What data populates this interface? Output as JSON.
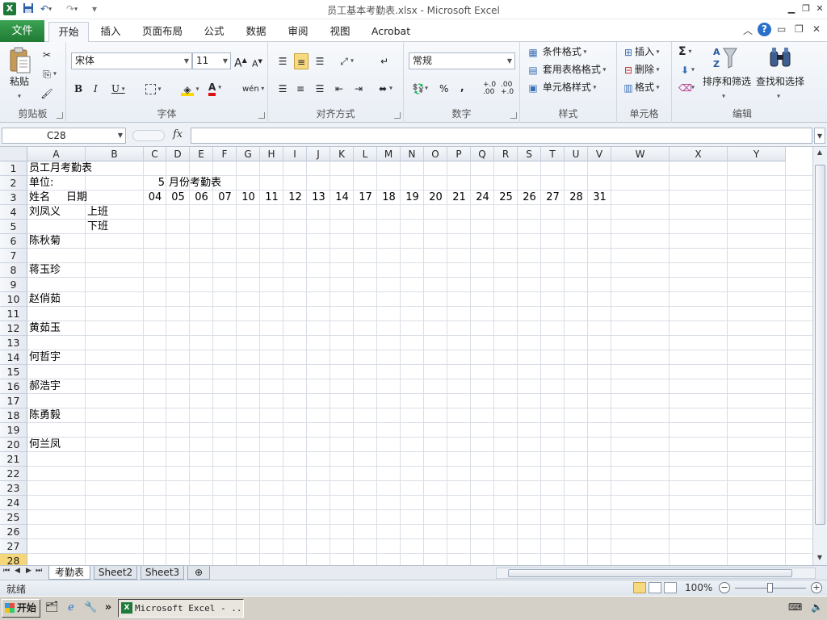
{
  "window": {
    "title": "员工基本考勤表.xlsx  -  Microsoft Excel",
    "logo": "X"
  },
  "ribbon_tabs": [
    "文件",
    "开始",
    "插入",
    "页面布局",
    "公式",
    "数据",
    "审阅",
    "视图",
    "Acrobat"
  ],
  "ribbon": {
    "clipboard": {
      "label": "剪贴板",
      "paste": "粘贴"
    },
    "font": {
      "label": "字体",
      "name": "宋体",
      "size": "11",
      "grow": "A",
      "shrink": "A",
      "bold": "B",
      "italic": "I",
      "underline": "U",
      "font_color": "A",
      "phonetic": "wén"
    },
    "alignment": {
      "label": "对齐方式"
    },
    "number": {
      "label": "数字",
      "format": "常规",
      "percent": "%",
      "comma": ",",
      "inc_decimal": "+.0 .00",
      "dec_decimal": ".00 +.0"
    },
    "styles": {
      "label": "样式",
      "conditional": "条件格式",
      "table": "套用表格格式",
      "cell_styles": "单元格样式"
    },
    "cells": {
      "label": "单元格",
      "insert": "插入",
      "delete": "删除",
      "format": "格式"
    },
    "editing": {
      "label": "编辑",
      "sum": "Σ",
      "sort_filter": "排序和筛选",
      "find_select": "查找和选择"
    }
  },
  "formula_bar": {
    "name_box": "C28",
    "fx": "fx",
    "value": ""
  },
  "columns": [
    "A",
    "B",
    "C",
    "D",
    "E",
    "F",
    "G",
    "H",
    "I",
    "J",
    "K",
    "L",
    "M",
    "N",
    "O",
    "P",
    "Q",
    "R",
    "S",
    "T",
    "U",
    "V",
    "W",
    "X",
    "Y"
  ],
  "rows": [
    "1",
    "2",
    "3",
    "4",
    "5",
    "6",
    "7",
    "8",
    "9",
    "10",
    "11",
    "12",
    "13",
    "14",
    "15",
    "16",
    "17",
    "18",
    "19",
    "20",
    "21",
    "22",
    "23",
    "24",
    "25",
    "26",
    "27",
    "28"
  ],
  "cells": {
    "A1": "员工月考勤表",
    "A2": "单位:",
    "C2": "5",
    "D2": "月份考勤表",
    "A3": "姓名",
    "A3b": "日期",
    "days": [
      "04",
      "05",
      "06",
      "07",
      "10",
      "11",
      "12",
      "13",
      "14",
      "17",
      "18",
      "19",
      "20",
      "21",
      "24",
      "25",
      "26",
      "27",
      "28",
      "31"
    ],
    "A4": "刘凤义",
    "B4": "上班",
    "B5": "下班",
    "A6": "陈秋菊",
    "A8": "蒋玉珍",
    "A10": "赵俏茹",
    "A12": "黄茹玉",
    "A14": "何哲宇",
    "A16": "郝浩宇",
    "A18": "陈勇毅",
    "A20": "何兰凤"
  },
  "sheets": [
    "考勤表",
    "Sheet2",
    "Sheet3"
  ],
  "status": {
    "ready": "就绪",
    "zoom": "100%",
    "zoom_out": "−",
    "zoom_in": "+"
  },
  "taskbar": {
    "start": "开始",
    "task": "Microsoft Excel - ...",
    "more": "»"
  },
  "colors": {
    "file_tab": "#217a34",
    "selected_row_header": "#f5d77a",
    "grid_line": "#d9dee6"
  },
  "icons": [
    "save-icon",
    "undo-icon",
    "redo-icon",
    "paste-icon",
    "cut-icon",
    "copy-icon",
    "format-painter-icon",
    "sort-filter-icon",
    "find-binoculars-icon",
    "help-icon"
  ]
}
